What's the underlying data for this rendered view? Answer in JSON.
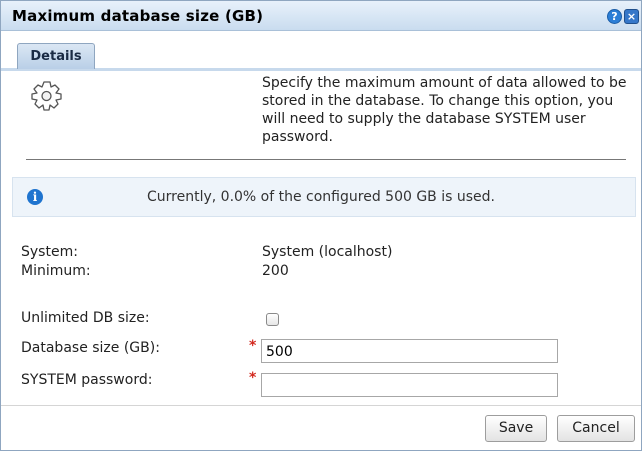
{
  "dialog": {
    "title": "Maximum database size (GB)",
    "help_symbol": "?",
    "close_symbol": "×"
  },
  "tabs": [
    {
      "label": "Details",
      "selected": true
    }
  ],
  "description": "Specify the maximum amount of data allowed to be stored in the database. To change this option, you will need to supply the database SYSTEM user password.",
  "icons": {
    "settings": "gear-icon",
    "info": "info-icon"
  },
  "info": {
    "symbol": "i",
    "text": "Currently, 0.0% of the configured 500 GB is used."
  },
  "fields": {
    "system_label": "System:",
    "system_value": "System (localhost)",
    "minimum_label": "Minimum:",
    "minimum_value": "200",
    "unlimited_label": "Unlimited DB size:",
    "unlimited_checked": false,
    "db_size_label": "Database size (GB):",
    "db_size_value": "500",
    "password_label": "SYSTEM password:",
    "password_value": "",
    "required_marker": "*"
  },
  "buttons": {
    "save": "Save",
    "cancel": "Cancel"
  },
  "colors": {
    "title_bar": "#c9dcef",
    "info_background": "#eef4fa",
    "required": "#d2281e",
    "accent": "#2c7ed6"
  }
}
